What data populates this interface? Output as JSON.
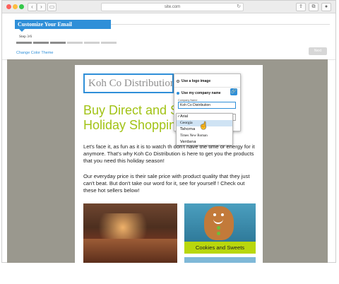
{
  "browser": {
    "url": "site.com",
    "back_icon": "chevron-left-icon",
    "forward_icon": "chevron-right-icon"
  },
  "wizard": {
    "title": "Customize Your Email",
    "step": "Step 3/6",
    "progress": {
      "current": 3,
      "total": 6
    },
    "theme_link": "Change Color Theme",
    "next_label": "Next"
  },
  "email": {
    "logo_text": "Koh Co Distribution",
    "logo_tail": "T",
    "headline_line1": "Buy Direct and S",
    "headline_line1_tail": "r",
    "headline_line2": "Holiday Shoppin",
    "paragraph1": "Let's face it, as fun as it is to watch th don't have the time or energy for it anymore. That's why Koh Co Distribution is here to get you the products that you need this holiday season!",
    "paragraph2": "Our everyday price is their sale price with product quality that they just can't beat. But don't take our word for it, see for yourself ! Check out these hot sellers below!",
    "product_caption": "Cookies and Sweets"
  },
  "logo_popup": {
    "option_logo": "Use a logo image",
    "option_name": "Use my company name",
    "selected_option": "Use my company name",
    "field_label": "Company Name",
    "company_name_value": "Koh Co Distribution",
    "font_options": [
      "Arial",
      "Georgia",
      "Tahoma",
      "Times New Roman",
      "Verdana"
    ],
    "checked_font": "Arial",
    "hovered_font": "Georgia"
  },
  "colors": {
    "accent": "#2f8fd8",
    "headline": "#a2c316",
    "caption_bg": "#b9d70d",
    "canvas_bg": "#9a988e"
  }
}
